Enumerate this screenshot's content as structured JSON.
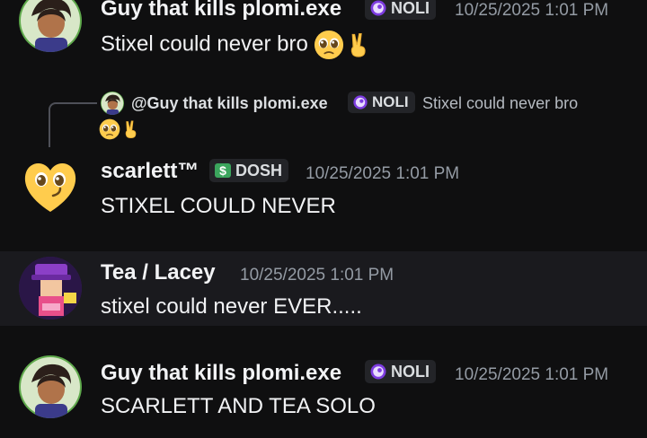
{
  "messages": [
    {
      "author": "Guy that kills plomi.exe",
      "tag": "NOLI",
      "timestamp": "10/25/2025 1:01 PM",
      "text": "Stixel could never bro"
    },
    {
      "reply": {
        "mention": "@Guy that kills plomi.exe",
        "tag": "NOLI",
        "text": "Stixel could never bro"
      },
      "author": "scarlett™",
      "tag": "DOSH",
      "timestamp": "10/25/2025 1:01 PM",
      "text": "STIXEL COULD NEVER"
    },
    {
      "author": "Tea / Lacey",
      "timestamp": "10/25/2025 1:01 PM",
      "text": "stixel could never EVER....."
    },
    {
      "author": "Guy that kills plomi.exe",
      "tag": "NOLI",
      "timestamp": "10/25/2025 1:01 PM",
      "text": "SCARLETT AND TEA SOLO"
    }
  ],
  "colors": {
    "background": "#0f0f10",
    "hover_row": "#1a1a1e",
    "noli_accent": "#9b59f5",
    "dosh_accent": "#2ecc71"
  },
  "icons": {
    "pleading_emoji": "pleading-face-icon",
    "victory_emoji": "victory-hand-icon",
    "noli_tag_icon": "purple-orb-icon",
    "dosh_tag_icon": "dollar-sign-icon"
  }
}
